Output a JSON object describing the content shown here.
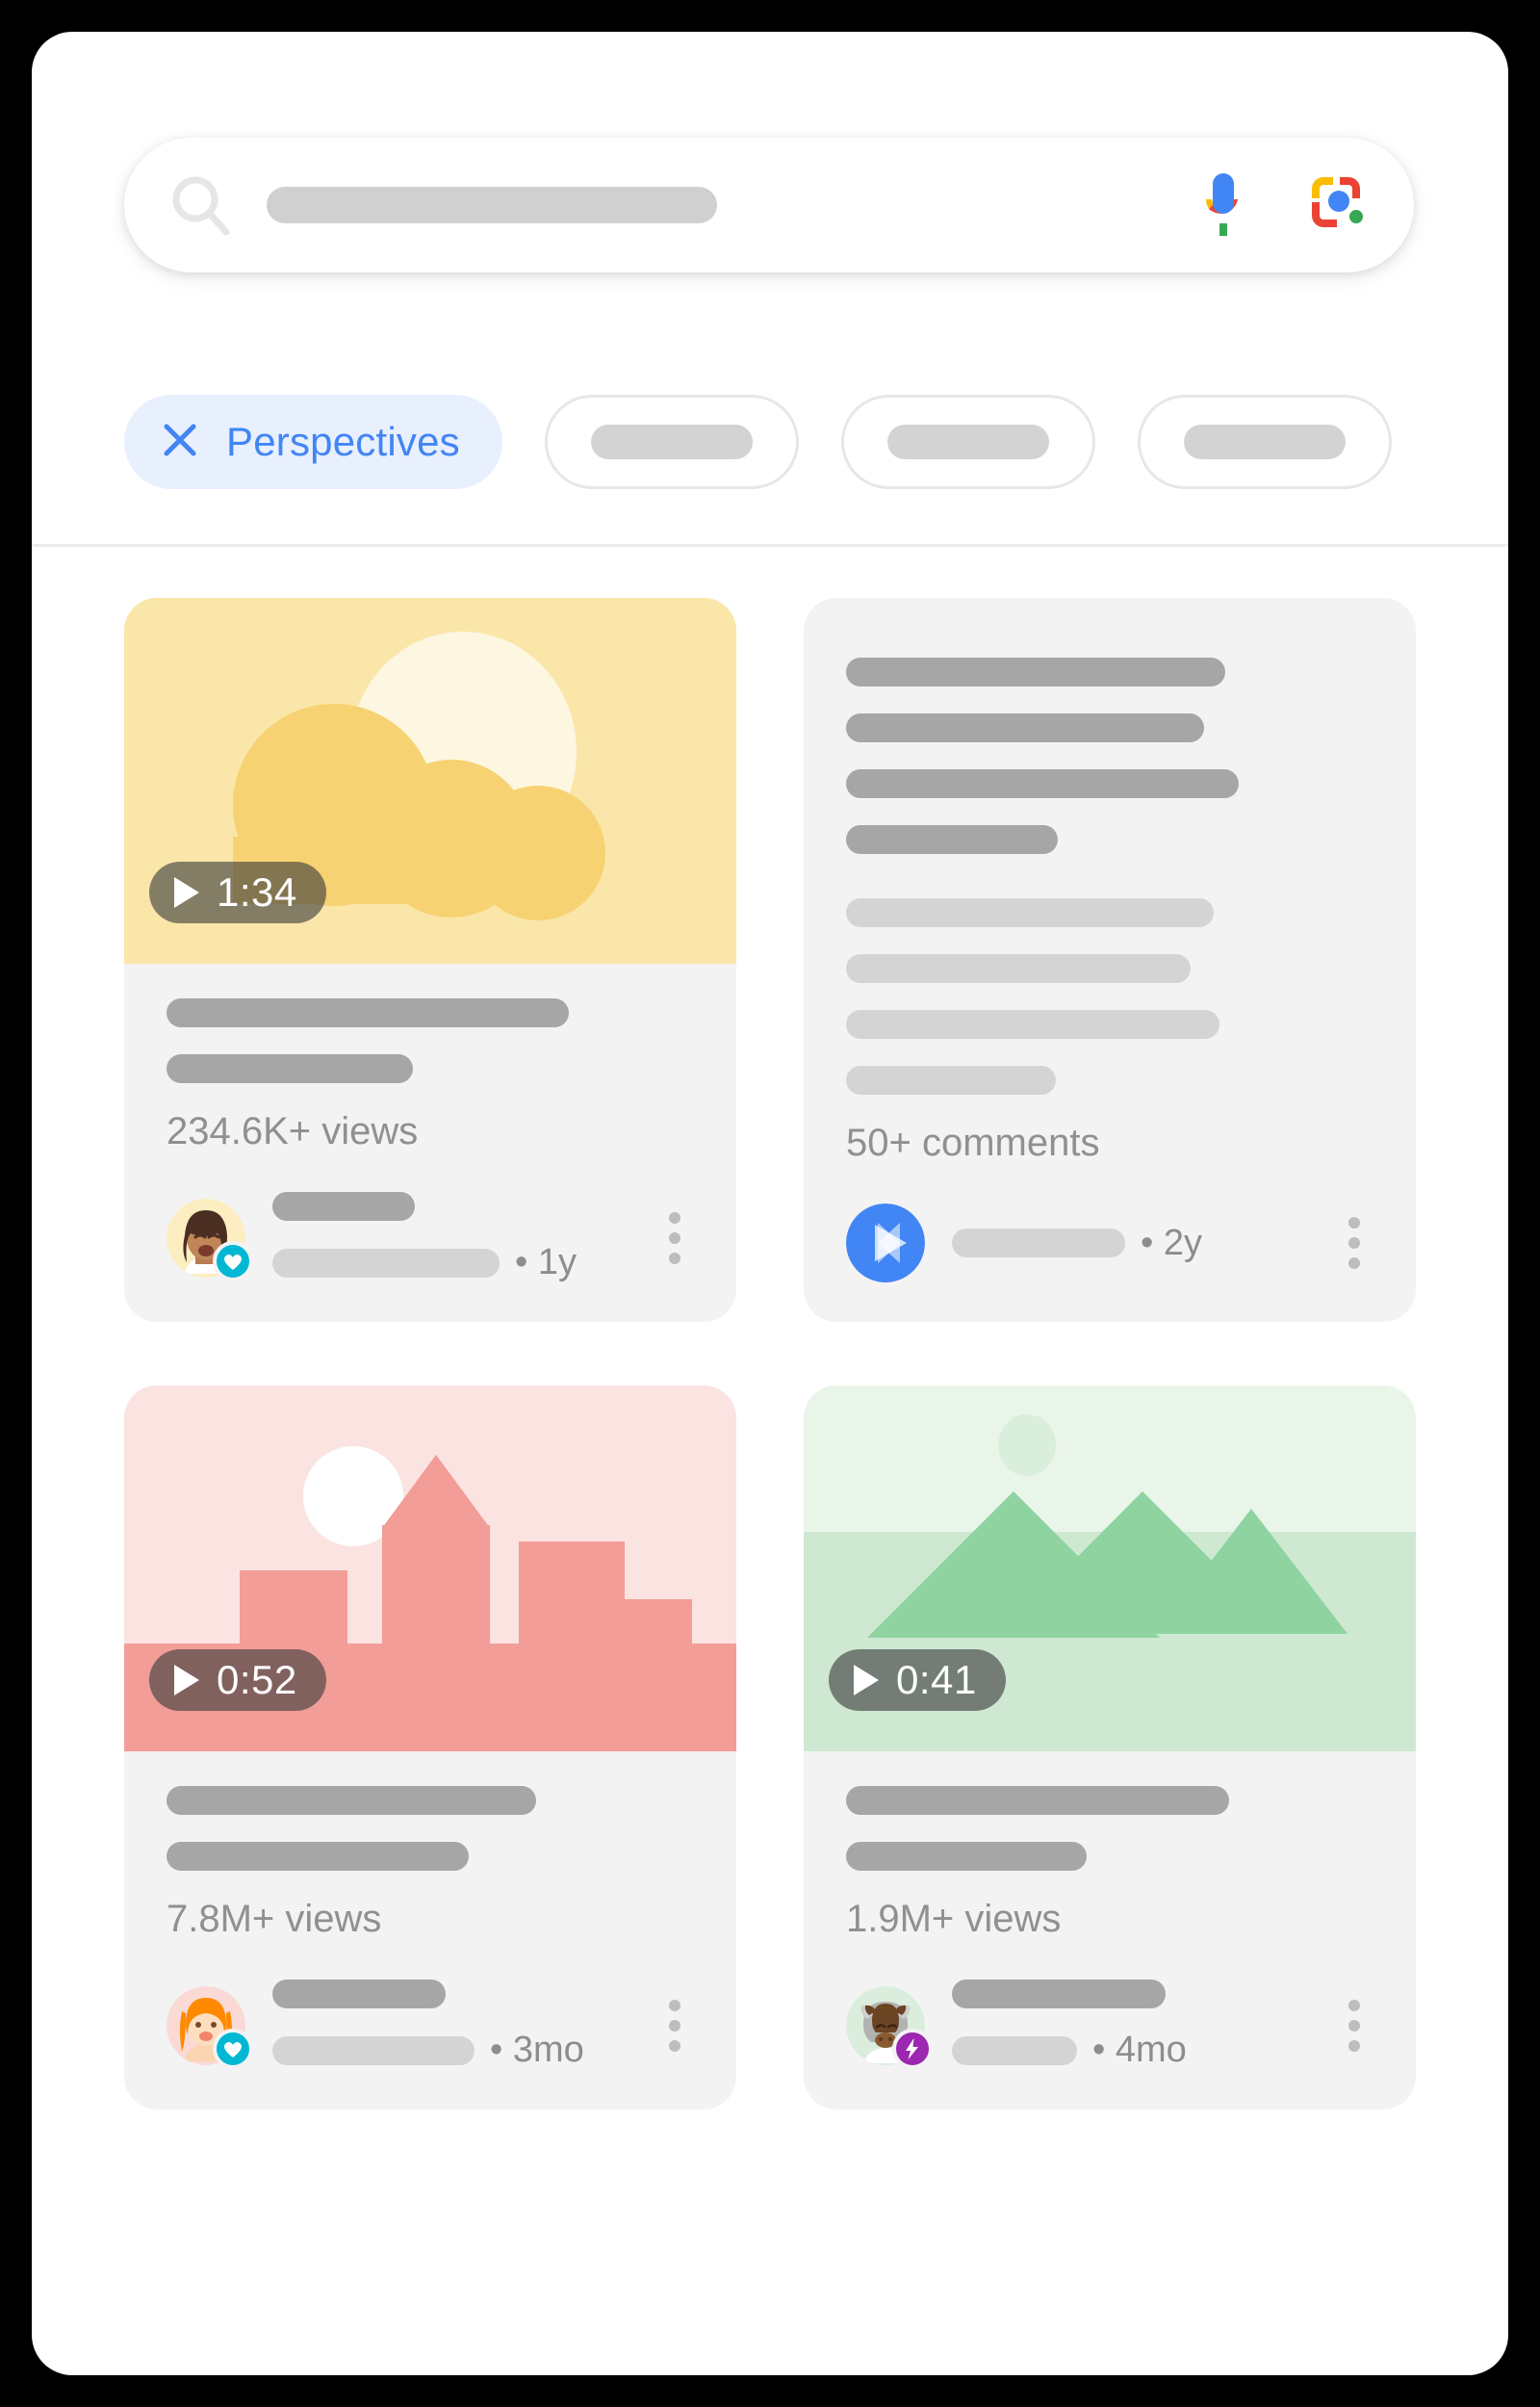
{
  "search": {
    "icon": "search-icon",
    "placeholder_value": "",
    "mic_icon": "microphone-icon",
    "lens_icon": "google-lens-icon"
  },
  "filters": {
    "active_chip": {
      "label": "Perspectives",
      "icon": "close-icon",
      "text_color": "#4285f4",
      "bg_color": "#e8f0fe"
    },
    "placeholder_chips": [
      {
        "label": ""
      },
      {
        "label": ""
      },
      {
        "label": ""
      }
    ]
  },
  "results": [
    {
      "type": "video",
      "thumbnail": "sun-and-clouds-illustration",
      "duration": "1:34",
      "views": "234.6K+ views",
      "avatar": "woman-avatar",
      "verified_badge": "heart-badge",
      "badge_color": "#00b8d4",
      "age": "• 1y",
      "menu": "more-options-icon"
    },
    {
      "type": "text",
      "thumbnail": "",
      "duration": "",
      "views": "50+ comments",
      "avatar": "play-star-avatar",
      "verified_badge": "",
      "badge_color": "#4285f4",
      "age": "• 2y",
      "menu": "more-options-icon"
    },
    {
      "type": "video",
      "thumbnail": "pink-cityscape-illustration",
      "duration": "0:52",
      "views": "7.8M+ views",
      "avatar": "orange-hair-woman-avatar",
      "verified_badge": "heart-badge",
      "badge_color": "#00b8d4",
      "age": "• 3mo",
      "menu": "more-options-icon"
    },
    {
      "type": "video",
      "thumbnail": "green-mountains-illustration",
      "duration": "0:41",
      "views": "1.9M+ views",
      "avatar": "bull-avatar",
      "verified_badge": "lightning-badge",
      "badge_color": "#9c27b0",
      "age": "• 4mo",
      "menu": "more-options-icon"
    }
  ],
  "colors": {
    "panel_bg": "#ffffff",
    "page_bg": "#000000",
    "card_bg": "#f3f3f3",
    "accent_blue": "#4285f4",
    "chip_bg": "#e8f0fe",
    "thumb_yellow": "#fae6a8",
    "thumb_pink": "#fbe3e2",
    "thumb_green": "#e9f4ea"
  }
}
